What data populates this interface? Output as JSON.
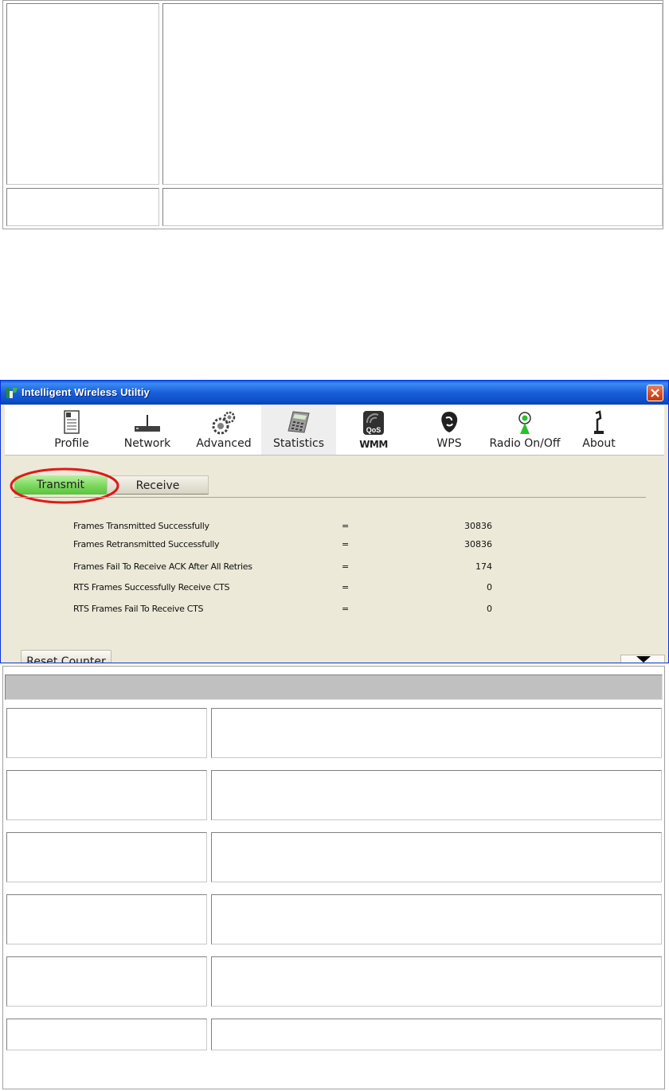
{
  "window": {
    "title": "Intelligent Wireless Utiltiy"
  },
  "toolbar": {
    "items": [
      {
        "label": "Profile",
        "icon": "profile-icon"
      },
      {
        "label": "Network",
        "icon": "network-router-icon"
      },
      {
        "label": "Advanced",
        "icon": "gears-icon"
      },
      {
        "label": "Statistics",
        "icon": "calculator-icon",
        "active": true
      },
      {
        "label": "WMM",
        "icon": "qos-icon"
      },
      {
        "label": "WPS",
        "icon": "wps-icon"
      },
      {
        "label": "Radio On/Off",
        "icon": "radio-antenna-icon"
      },
      {
        "label": "About",
        "icon": "about-icon"
      }
    ]
  },
  "tabs": {
    "transmit": "Transmit",
    "receive": "Receive",
    "active": "transmit"
  },
  "stats": [
    {
      "label": "Frames Transmitted Successfully",
      "eq": "=",
      "value": "30836"
    },
    {
      "label": "Frames Retransmitted Successfully",
      "eq": "=",
      "value": "30836"
    },
    {
      "label": "Frames Fail To Receive ACK After All Retries",
      "eq": "=",
      "value": "174"
    },
    {
      "label": "RTS Frames Successfully Receive CTS",
      "eq": "=",
      "value": "0"
    },
    {
      "label": "RTS Frames Fail To Receive CTS",
      "eq": "=",
      "value": "0"
    }
  ],
  "buttons": {
    "reset": "Reset Counter"
  },
  "colors": {
    "titlebar": "#0c4fc9",
    "window_bg": "#ece9d8",
    "active_tab": "#7ad85c",
    "highlight": "#e01818"
  }
}
